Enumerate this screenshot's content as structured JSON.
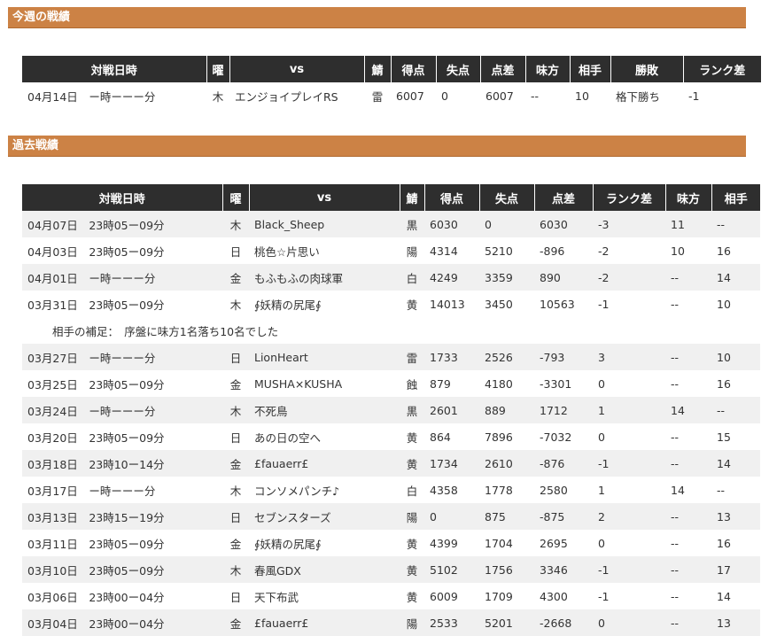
{
  "sections": {
    "this_week": "今週の戦績",
    "past": "過去戦績"
  },
  "this_week": {
    "headers": [
      "対戦日時",
      "曜",
      "vs",
      "鯖",
      "得点",
      "失点",
      "点差",
      "味方",
      "相手",
      "勝敗",
      "ランク差"
    ],
    "row": [
      "04月14日",
      "ー時ーーー分",
      "木",
      "エンジョイプレイRS",
      "雷",
      "6007",
      "0",
      "6007",
      "--",
      "10",
      "格下勝ち",
      "-1"
    ]
  },
  "past": {
    "headers": [
      "対戦日時",
      "曜",
      "vs",
      "鯖",
      "得点",
      "失点",
      "点差",
      "ランク差",
      "味方",
      "相手"
    ],
    "rows": [
      [
        "04月07日",
        "23時05ー09分",
        "木",
        "Black_Sheep",
        "黒",
        "6030",
        "0",
        "6030",
        "-3",
        "11",
        "--"
      ],
      [
        "04月03日",
        "23時05ー09分",
        "日",
        "桃色☆片思い",
        "陽",
        "4314",
        "5210",
        "-896",
        "-2",
        "10",
        "16"
      ],
      [
        "04月01日",
        "ー時ーーー分",
        "金",
        "もふもふの肉球軍",
        "白",
        "4249",
        "3359",
        "890",
        "-2",
        "--",
        "14"
      ],
      [
        "03月31日",
        "23時05ー09分",
        "木",
        "∮妖精の尻尾∮",
        "黄",
        "14013",
        "3450",
        "10563",
        "-1",
        "--",
        "10"
      ],
      [
        "03月27日",
        "ー時ーーー分",
        "日",
        "LionHeart",
        "雷",
        "1733",
        "2526",
        "-793",
        "3",
        "--",
        "10"
      ],
      [
        "03月25日",
        "23時05ー09分",
        "金",
        "MUSHA×KUSHA",
        "蝕",
        "879",
        "4180",
        "-3301",
        "0",
        "--",
        "16"
      ],
      [
        "03月24日",
        "ー時ーーー分",
        "木",
        "不死鳥",
        "黒",
        "2601",
        "889",
        "1712",
        "1",
        "14",
        "--"
      ],
      [
        "03月20日",
        "23時05ー09分",
        "日",
        "あの日の空へ",
        "黄",
        "864",
        "7896",
        "-7032",
        "0",
        "--",
        "15"
      ],
      [
        "03月18日",
        "23時10ー14分",
        "金",
        "£fauaerr£",
        "黄",
        "1734",
        "2610",
        "-876",
        "-1",
        "--",
        "14"
      ],
      [
        "03月17日",
        "ー時ーーー分",
        "木",
        "コンソメパンチ♪",
        "白",
        "4358",
        "1778",
        "2580",
        "1",
        "14",
        "--"
      ],
      [
        "03月13日",
        "23時15ー19分",
        "日",
        "セブンスターズ",
        "陽",
        "0",
        "875",
        "-875",
        "2",
        "--",
        "13"
      ],
      [
        "03月11日",
        "23時05ー09分",
        "金",
        "∮妖精の尻尾∮",
        "黄",
        "4399",
        "1704",
        "2695",
        "0",
        "--",
        "16"
      ],
      [
        "03月10日",
        "23時05ー09分",
        "木",
        "春風GDX",
        "黄",
        "5102",
        "1756",
        "3346",
        "-1",
        "--",
        "17"
      ],
      [
        "03月06日",
        "23時00ー04分",
        "日",
        "天下布武",
        "黄",
        "6009",
        "1709",
        "4300",
        "-1",
        "--",
        "14"
      ],
      [
        "03月04日",
        "23時00ー04分",
        "金",
        "£fauaerr£",
        "陽",
        "2533",
        "5201",
        "-2668",
        "0",
        "--",
        "13"
      ]
    ],
    "note": "相手の補足：　序盤に味方1名落ち10名でした"
  }
}
